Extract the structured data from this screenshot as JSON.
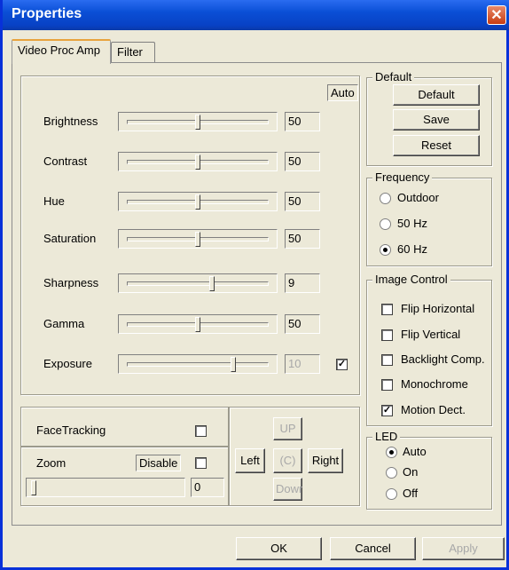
{
  "window": {
    "title": "Properties",
    "close_glyph": "✕"
  },
  "tabs": [
    {
      "label": "Video Proc Amp",
      "active": true
    },
    {
      "label": "Filter",
      "active": false
    }
  ],
  "proc_amp": {
    "auto_label": "Auto",
    "sliders": [
      {
        "label": "Brightness",
        "value": "50",
        "level": 0.5
      },
      {
        "label": "Contrast",
        "value": "50",
        "level": 0.5
      },
      {
        "label": "Hue",
        "value": "50",
        "level": 0.5
      },
      {
        "label": "Saturation",
        "value": "50",
        "level": 0.5
      },
      {
        "label": "Sharpness",
        "value": "9",
        "level": 0.6
      },
      {
        "label": "Gamma",
        "value": "50",
        "level": 0.5
      },
      {
        "label": "Exposure",
        "value": "10",
        "level": 0.75,
        "disabled": true,
        "auto_checked": true
      }
    ]
  },
  "default_group": {
    "title": "Default",
    "buttons": [
      "Default",
      "Save",
      "Reset"
    ]
  },
  "frequency": {
    "title": "Frequency",
    "options": [
      "Outdoor",
      "50 Hz",
      "60 Hz"
    ],
    "selected": "60 Hz"
  },
  "image_control": {
    "title": "Image Control",
    "options": [
      {
        "label": "Flip Horizontal",
        "checked": false
      },
      {
        "label": "Flip Vertical",
        "checked": false
      },
      {
        "label": "Backlight Comp.",
        "checked": false
      },
      {
        "label": "Monochrome",
        "checked": false
      },
      {
        "label": "Motion Dect.",
        "checked": true
      }
    ]
  },
  "led": {
    "title": "LED",
    "options": [
      "Auto",
      "On",
      "Off"
    ],
    "selected": "Auto"
  },
  "face_tracking": {
    "label": "FaceTracking",
    "checked": false
  },
  "zoom": {
    "label": "Zoom",
    "disable_label": "Disable",
    "disable_checked": false,
    "value": "0",
    "level": 0.0
  },
  "pan": {
    "up": "UP",
    "left": "Left",
    "center": "(C)",
    "right": "Right",
    "down": "Dowr"
  },
  "footer": {
    "ok": "OK",
    "cancel": "Cancel",
    "apply": "Apply"
  }
}
